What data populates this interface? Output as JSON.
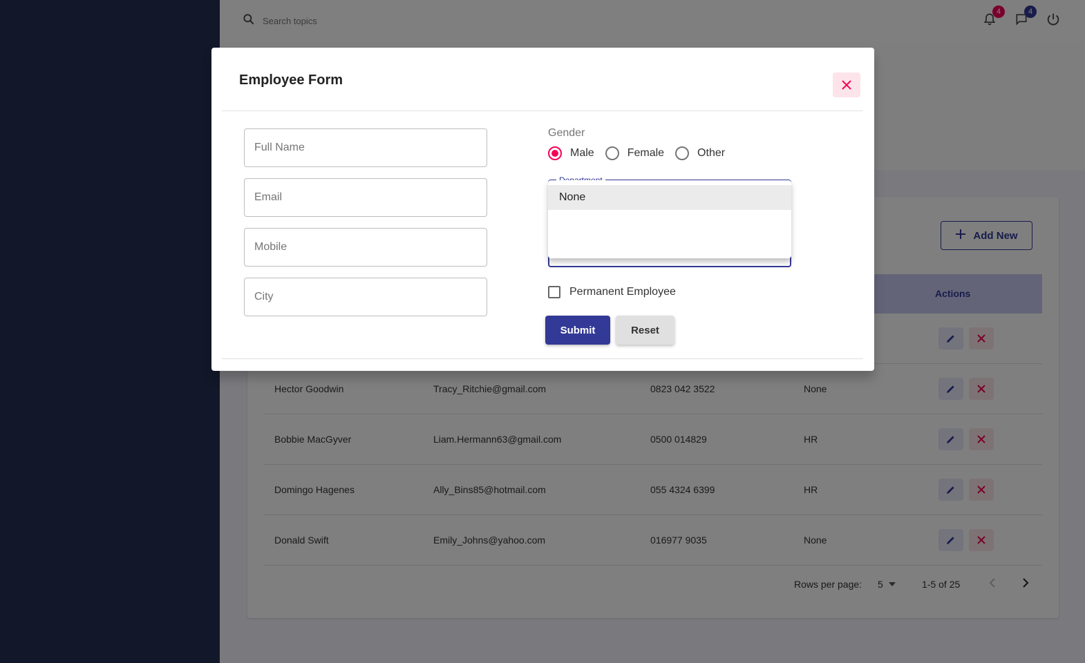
{
  "colors": {
    "primary": "#333996",
    "secondary": "#f50057",
    "sidebar": "#253053"
  },
  "header": {
    "search_placeholder": "Search topics",
    "notifications_count": "4",
    "messages_count": "4"
  },
  "card": {
    "add_new_label": "Add New",
    "columns": {
      "actions": "Actions"
    },
    "rows": [
      {
        "name": "Hector Goodwin",
        "email": "Tracy_Ritchie@gmail.com",
        "mobile": "0823 042 3522",
        "department": "None"
      },
      {
        "name": "Bobbie MacGyver",
        "email": "Liam.Hermann63@gmail.com",
        "mobile": "0500 014829",
        "department": "HR"
      },
      {
        "name": "Domingo Hagenes",
        "email": "Ally_Bins85@hotmail.com",
        "mobile": "055 4324 6399",
        "department": "HR"
      },
      {
        "name": "Donald Swift",
        "email": "Emily_Johns@yahoo.com",
        "mobile": "016977 9035",
        "department": "None"
      }
    ],
    "pagination": {
      "rows_per_page_label": "Rows per page:",
      "rows_per_page": "5",
      "range": "1-5 of 25"
    }
  },
  "dialog": {
    "title": "Employee Form",
    "fields": {
      "full_name": {
        "placeholder": "Full Name",
        "value": ""
      },
      "email": {
        "placeholder": "Email",
        "value": ""
      },
      "mobile": {
        "placeholder": "Mobile",
        "value": ""
      },
      "city": {
        "placeholder": "City",
        "value": ""
      }
    },
    "gender": {
      "label": "Gender",
      "options": [
        "Male",
        "Female",
        "Other"
      ],
      "selected": "Male"
    },
    "department": {
      "label": "Department",
      "menu_options": [
        "None"
      ]
    },
    "permanent_label": "Permanent Employee",
    "submit_label": "Submit",
    "reset_label": "Reset"
  }
}
